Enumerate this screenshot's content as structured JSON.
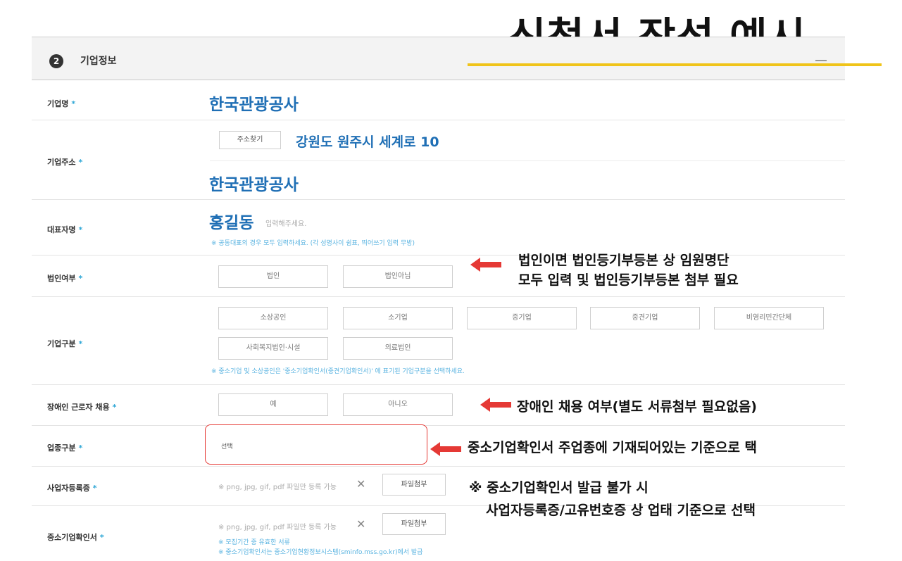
{
  "slide_title": "신청서 작성 예시",
  "section": {
    "number": "2",
    "label": "기업정보"
  },
  "required_mark": "*",
  "fields": {
    "company_name": {
      "label": "기업명",
      "value": "한국관광공사"
    },
    "company_address": {
      "label": "기업주소",
      "search_button": "주소찾기",
      "address": "강원도 원주시 세계로 10",
      "detail": "한국관광공사"
    },
    "representative": {
      "label": "대표자명",
      "value": "홍길동",
      "placeholder": "입력해주세요.",
      "hint": "※ 공동대표의 경우 모두 입력하세요. (각 성명사이 쉼표, 띄어쓰기 입력 무방)"
    },
    "corporation": {
      "label": "법인여부",
      "options": [
        "법인",
        "법인아님"
      ]
    },
    "company_type": {
      "label": "기업구분",
      "options": [
        "소상공인",
        "소기업",
        "중기업",
        "중견기업",
        "비영리민간단체",
        "사회복지법인·시설",
        "의료법인"
      ],
      "hint": "※ 중소기업 및 소상공인은 '중소기업확인서(중견기업확인서)' 에 표기된 기업구분을 선택하세요."
    },
    "disabled_hiring": {
      "label": "장애인 근로자 채용",
      "options": [
        "예",
        "아니오"
      ]
    },
    "industry": {
      "label": "업종구분",
      "value": "선택"
    },
    "business_registration": {
      "label": "사업자등록증",
      "file_hint": "※ png, jpg, gif, pdf 파일만 등록 가능",
      "attach_button": "파일첨부"
    },
    "sme_certificate": {
      "label": "중소기업확인서",
      "file_hint": "※ png, jpg, gif, pdf 파일만 등록 가능",
      "attach_button": "파일첨부",
      "hint1": "※ 모집기간 중 유효한 서류",
      "hint2": "※ 중소기업확인서는 중소기업현황정보시스템(sminfo.mss.go.kr)에서 발급"
    }
  },
  "annotations": {
    "corporation": [
      "법인이면 법인등기부등본 상 임원명단",
      "모두 입력 및 법인등기부등본 첨부 필요"
    ],
    "disabled": "장애인 채용 여부(별도 서류첨부 필요없음)",
    "industry": "중소기업확인서 주업종에 기재되어있는 기준으로 택",
    "business": [
      "※ 중소기업확인서 발급 불가 시",
      "사업자등록증/고유번호증 상 업태 기준으로 선택"
    ]
  },
  "colors": {
    "accent_blue": "#1f6fb5",
    "hint_blue": "#59b3e0",
    "title_underline": "#f0c419",
    "annotation_red": "#e53935"
  }
}
